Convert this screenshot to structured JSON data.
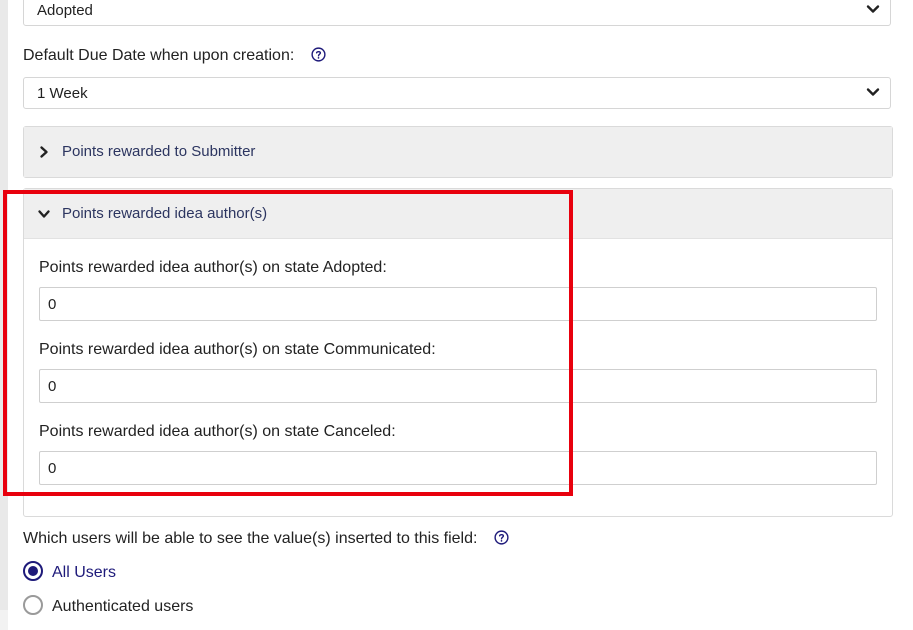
{
  "state_select": {
    "value": "Adopted"
  },
  "due_date": {
    "label": "Default Due Date when upon creation:",
    "value": "1 Week"
  },
  "accordion_submitter": {
    "title": "Points rewarded to Submitter"
  },
  "accordion_authors": {
    "title": "Points rewarded idea author(s)",
    "fields": [
      {
        "label": "Points rewarded idea author(s) on state Adopted:",
        "value": "0"
      },
      {
        "label": "Points rewarded idea author(s) on state Communicated:",
        "value": "0"
      },
      {
        "label": "Points rewarded idea author(s) on state Canceled:",
        "value": "0"
      }
    ]
  },
  "visibility": {
    "label": "Which users will be able to see the value(s) inserted to this field:",
    "options": [
      {
        "label": "All Users",
        "selected": true
      },
      {
        "label": "Authenticated users",
        "selected": false
      }
    ]
  },
  "colors": {
    "accent": "#1e1a7a",
    "highlight": "#e8000d",
    "accordion_title": "#2c3560"
  },
  "icons": [
    "chevron-down-icon",
    "chevron-right-icon",
    "help-icon"
  ]
}
